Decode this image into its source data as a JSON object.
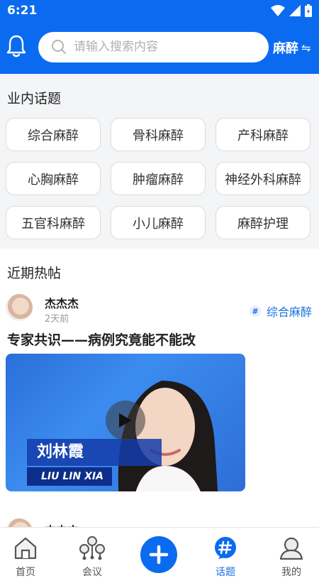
{
  "status": {
    "time": "6:21"
  },
  "header": {
    "search_placeholder": "请输入搜索内容",
    "category": "麻醉",
    "switch_glyph": "⇋"
  },
  "topics": {
    "title": "业内话题",
    "items": [
      "综合麻醉",
      "骨科麻醉",
      "产科麻醉",
      "心胸麻醉",
      "肿瘤麻醉",
      "神经外科麻醉",
      "五官科麻醉",
      "小儿麻醉",
      "麻醉护理"
    ]
  },
  "hot": {
    "title": "近期热帖",
    "posts": [
      {
        "author": "杰杰杰",
        "time": "2天前",
        "tag": "综合麻醉",
        "title": "专家共识——病例究竟能不能改",
        "video_name": "刘林霞",
        "video_name_en": "LIU LIN XIA"
      },
      {
        "author": "杰杰杰"
      }
    ]
  },
  "tabbar": {
    "items": [
      {
        "label": "首页",
        "icon": "home-icon"
      },
      {
        "label": "会议",
        "icon": "meeting-network-icon"
      },
      {
        "label": "",
        "icon": "plus-icon"
      },
      {
        "label": "话题",
        "icon": "hashtag-icon"
      },
      {
        "label": "我的",
        "icon": "profile-icon"
      }
    ],
    "active": "话题",
    "accent": "#0b6bf0"
  },
  "colors": {
    "primary": "#0b6bf0",
    "link": "#1a6fe0"
  }
}
